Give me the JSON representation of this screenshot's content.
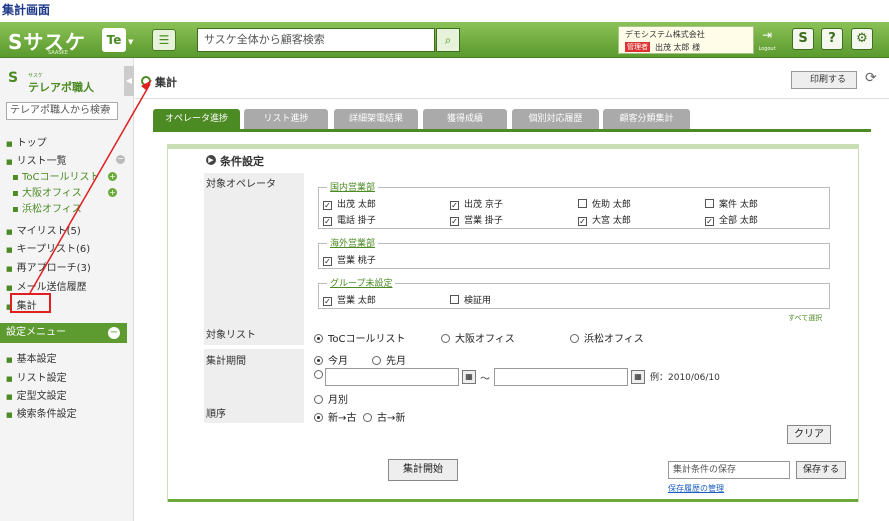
{
  "page_caption": "集計画面",
  "header": {
    "logo": "Sサスケ",
    "logo_sub": "SAASKE",
    "te_label": "Te",
    "search_placeholder": "サスケ全体から顧客検索",
    "company": "デモシステム株式会社",
    "role_badge": "管理者",
    "user_name": "出茂 太郎 様",
    "logout_label": "Logout",
    "icons": [
      "s-icon",
      "help-icon",
      "settings-icon"
    ]
  },
  "sidebar": {
    "logo_sub": "サスケ",
    "logo_main": "テレアポ職人",
    "search_placeholder": "テレアポ職人から検索",
    "items": [
      {
        "label": "トップ"
      },
      {
        "label": "リスト一覧"
      },
      {
        "label": "ToCコールリスト"
      },
      {
        "label": "大阪オフィス"
      },
      {
        "label": "浜松オフィス"
      },
      {
        "label": "マイリスト(5)"
      },
      {
        "label": "キープリスト(6)"
      },
      {
        "label": "再アプローチ(3)"
      },
      {
        "label": "メール送信履歴"
      },
      {
        "label": "集計"
      }
    ],
    "settings_header": "設定メニュー",
    "settings_items": [
      {
        "label": "基本設定"
      },
      {
        "label": "リスト設定"
      },
      {
        "label": "定型文設定"
      },
      {
        "label": "検索条件設定"
      }
    ]
  },
  "main": {
    "title": "集計",
    "print_label": "印刷する",
    "tabs": [
      {
        "label": "オペレータ進捗",
        "active": true
      },
      {
        "label": "リスト進捗"
      },
      {
        "label": "詳細架電結果"
      },
      {
        "label": "獲得成績"
      },
      {
        "label": "個別対応履歴"
      },
      {
        "label": "顧客分類集計"
      }
    ],
    "conditions_title": "条件設定",
    "operator_label": "対象オペレータ",
    "groups": [
      {
        "name": "国内営業部",
        "members": [
          {
            "name": "出茂 太郎",
            "checked": true
          },
          {
            "name": "出茂 京子",
            "checked": true
          },
          {
            "name": "佐助 太郎",
            "checked": false
          },
          {
            "name": "案件 太郎",
            "checked": false
          },
          {
            "name": "電話 掛子",
            "checked": true
          },
          {
            "name": "営業 掛子",
            "checked": true
          },
          {
            "name": "大宮 太郎",
            "checked": true
          },
          {
            "name": "全部 太郎",
            "checked": true
          }
        ]
      },
      {
        "name": "海外営業部",
        "members": [
          {
            "name": "営業 桃子",
            "checked": true
          }
        ]
      },
      {
        "name": "グループ未設定",
        "members": [
          {
            "name": "営業 太郎",
            "checked": true
          },
          {
            "name": "検証用",
            "checked": false
          }
        ]
      }
    ],
    "select_all": "すべて選択",
    "list_label": "対象リスト",
    "list_options": [
      {
        "label": "ToCコールリスト",
        "selected": true
      },
      {
        "label": "大阪オフィス",
        "selected": false
      },
      {
        "label": "浜松オフィス",
        "selected": false
      }
    ],
    "period_label": "集計期間",
    "period_options": [
      {
        "label": "今月",
        "selected": true
      },
      {
        "label": "先月",
        "selected": false
      },
      {
        "label": "月別",
        "selected": false
      }
    ],
    "tilde": "～",
    "date_example": "例：2010/06/10",
    "order_label": "順序",
    "order_options": [
      {
        "label": "新→古",
        "selected": true
      },
      {
        "label": "古→新",
        "selected": false
      }
    ],
    "clear_label": "クリア",
    "start_label": "集計開始",
    "save_placeholder": "集計条件の保存",
    "save_label": "保存する",
    "history_link": "保存履歴の管理"
  }
}
